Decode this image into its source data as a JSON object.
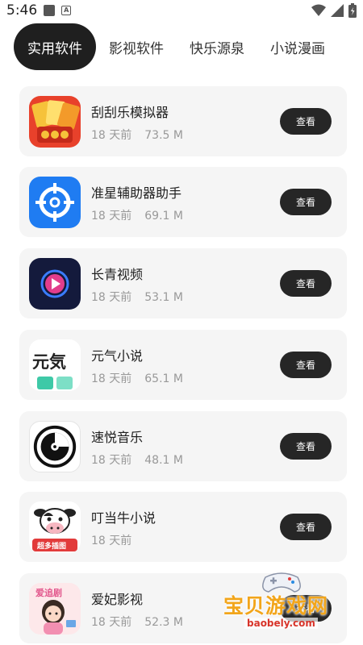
{
  "status_bar": {
    "time": "5:46",
    "app_icon_letter": "A"
  },
  "tabs": [
    {
      "label": "实用软件",
      "active": true
    },
    {
      "label": "影视软件",
      "active": false
    },
    {
      "label": "快乐源泉",
      "active": false
    },
    {
      "label": "小说漫画",
      "active": false
    }
  ],
  "apps": [
    {
      "name": "刮刮乐模拟器",
      "age": "18 天前",
      "size": "73.5 M",
      "button": "查看",
      "icon": "scratch-lottery-icon"
    },
    {
      "name": "准星辅助器助手",
      "age": "18 天前",
      "size": "69.1 M",
      "button": "查看",
      "icon": "crosshair-icon"
    },
    {
      "name": "长青视频",
      "age": "18 天前",
      "size": "53.1 M",
      "button": "查看",
      "icon": "video-play-icon"
    },
    {
      "name": "元气小说",
      "age": "18 天前",
      "size": "65.1 M",
      "button": "查看",
      "icon": "yuanqi-book-icon",
      "icon_text": "元気"
    },
    {
      "name": "速悦音乐",
      "age": "18 天前",
      "size": "48.1 M",
      "button": "查看",
      "icon": "vinyl-disc-icon"
    },
    {
      "name": "叮当牛小说",
      "age": "18 天前",
      "size": "",
      "button": "查看",
      "icon": "cow-mascot-icon",
      "icon_text": "超多插图"
    },
    {
      "name": "爱妃影视",
      "age": "18 天前",
      "size": "52.3 M",
      "button": "查看",
      "icon": "girl-illustration-icon",
      "icon_text": "爱追剧"
    }
  ],
  "watermark": {
    "text": "宝贝游戏网",
    "url": "baobely.com"
  },
  "colors": {
    "accent_dark": "#1f1f1f",
    "card_bg": "#f5f5f5",
    "meta_gray": "#999999"
  }
}
